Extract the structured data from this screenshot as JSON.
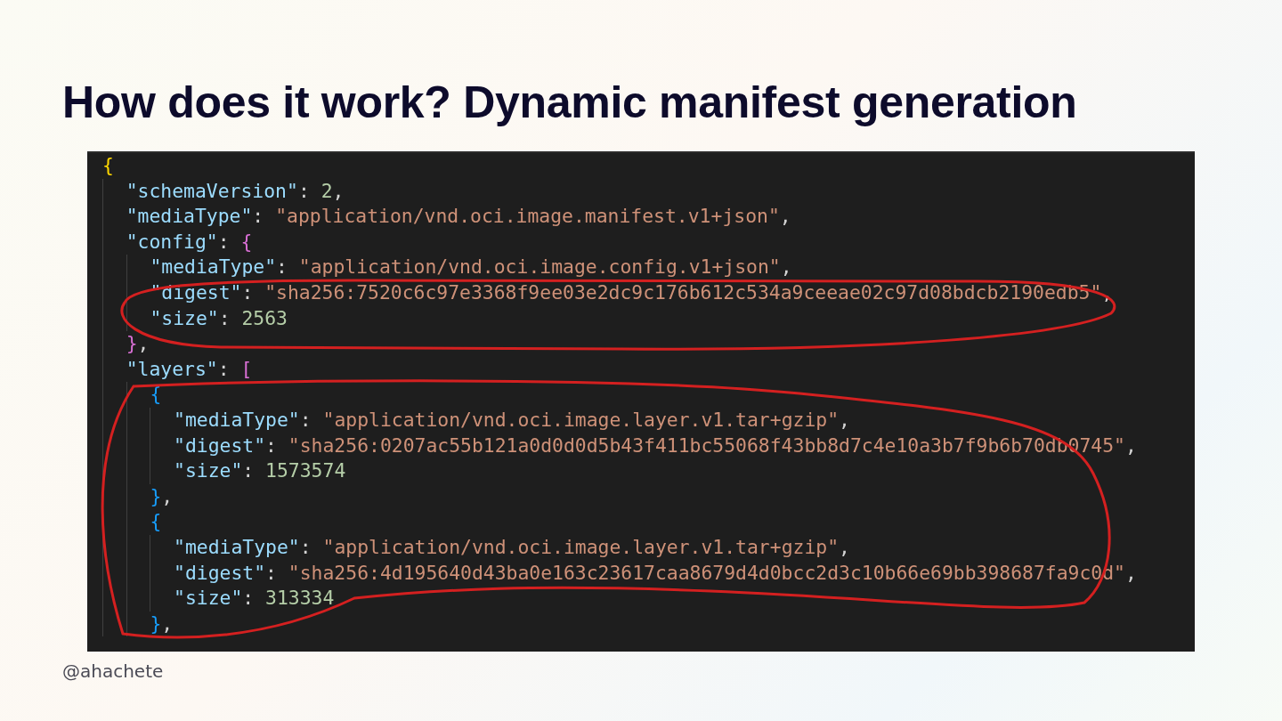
{
  "slide": {
    "title": "How does it work? Dynamic manifest generation",
    "handle": "@ahachete"
  },
  "code": [
    {
      "tokens": [
        {
          "kind": "brace",
          "text": "{",
          "color": "#ffd700"
        }
      ],
      "children": [
        {
          "tokens": [
            {
              "kind": "key",
              "text": "\"schemaVersion\""
            },
            {
              "kind": "punct",
              "text": ": "
            },
            {
              "kind": "num",
              "text": "2"
            },
            {
              "kind": "punct",
              "text": ","
            }
          ]
        },
        {
          "tokens": [
            {
              "kind": "key",
              "text": "\"mediaType\""
            },
            {
              "kind": "punct",
              "text": ": "
            },
            {
              "kind": "str",
              "text": "\"application/vnd.oci.image.manifest.v1+json\""
            },
            {
              "kind": "punct",
              "text": ","
            }
          ]
        },
        {
          "tokens": [
            {
              "kind": "key",
              "text": "\"config\""
            },
            {
              "kind": "punct",
              "text": ": "
            },
            {
              "kind": "brace",
              "text": "{",
              "color": "#da70d6"
            }
          ],
          "children": [
            {
              "tokens": [
                {
                  "kind": "key",
                  "text": "\"mediaType\""
                },
                {
                  "kind": "punct",
                  "text": ": "
                },
                {
                  "kind": "str",
                  "text": "\"application/vnd.oci.image.config.v1+json\""
                },
                {
                  "kind": "punct",
                  "text": ","
                }
              ]
            },
            {
              "tokens": [
                {
                  "kind": "key",
                  "text": "\"digest\""
                },
                {
                  "kind": "punct",
                  "text": ": "
                },
                {
                  "kind": "str",
                  "text": "\"sha256:7520c6c97e3368f9ee03e2dc9c176b612c534a9ceeae02c97d08bdcb2190edb5\""
                },
                {
                  "kind": "punct",
                  "text": ","
                }
              ]
            },
            {
              "tokens": [
                {
                  "kind": "key",
                  "text": "\"size\""
                },
                {
                  "kind": "punct",
                  "text": ": "
                },
                {
                  "kind": "num",
                  "text": "2563"
                }
              ]
            }
          ]
        },
        {
          "tokens": [
            {
              "kind": "brace",
              "text": "}",
              "color": "#da70d6"
            },
            {
              "kind": "punct",
              "text": ","
            }
          ]
        },
        {
          "tokens": [
            {
              "kind": "key",
              "text": "\"layers\""
            },
            {
              "kind": "punct",
              "text": ": "
            },
            {
              "kind": "brace",
              "text": "[",
              "color": "#da70d6"
            }
          ],
          "children": [
            {
              "tokens": [
                {
                  "kind": "brace",
                  "text": "{",
                  "color": "#179fff"
                }
              ],
              "children": [
                {
                  "tokens": [
                    {
                      "kind": "key",
                      "text": "\"mediaType\""
                    },
                    {
                      "kind": "punct",
                      "text": ": "
                    },
                    {
                      "kind": "str",
                      "text": "\"application/vnd.oci.image.layer.v1.tar+gzip\""
                    },
                    {
                      "kind": "punct",
                      "text": ","
                    }
                  ]
                },
                {
                  "tokens": [
                    {
                      "kind": "key",
                      "text": "\"digest\""
                    },
                    {
                      "kind": "punct",
                      "text": ": "
                    },
                    {
                      "kind": "str",
                      "text": "\"sha256:0207ac55b121a0d0d0d5b43f411bc55068f43bb8d7c4e10a3b7f9b6b70db0745\""
                    },
                    {
                      "kind": "punct",
                      "text": ","
                    }
                  ]
                },
                {
                  "tokens": [
                    {
                      "kind": "key",
                      "text": "\"size\""
                    },
                    {
                      "kind": "punct",
                      "text": ": "
                    },
                    {
                      "kind": "num",
                      "text": "1573574"
                    }
                  ]
                }
              ]
            },
            {
              "tokens": [
                {
                  "kind": "brace",
                  "text": "}",
                  "color": "#179fff"
                },
                {
                  "kind": "punct",
                  "text": ","
                }
              ]
            },
            {
              "tokens": [
                {
                  "kind": "brace",
                  "text": "{",
                  "color": "#179fff"
                }
              ],
              "children": [
                {
                  "tokens": [
                    {
                      "kind": "key",
                      "text": "\"mediaType\""
                    },
                    {
                      "kind": "punct",
                      "text": ": "
                    },
                    {
                      "kind": "str",
                      "text": "\"application/vnd.oci.image.layer.v1.tar+gzip\""
                    },
                    {
                      "kind": "punct",
                      "text": ","
                    }
                  ]
                },
                {
                  "tokens": [
                    {
                      "kind": "key",
                      "text": "\"digest\""
                    },
                    {
                      "kind": "punct",
                      "text": ": "
                    },
                    {
                      "kind": "str",
                      "text": "\"sha256:4d195640d43ba0e163c23617caa8679d4d0bcc2d3c10b66e69bb398687fa9c0d\""
                    },
                    {
                      "kind": "punct",
                      "text": ","
                    }
                  ]
                },
                {
                  "tokens": [
                    {
                      "kind": "key",
                      "text": "\"size\""
                    },
                    {
                      "kind": "punct",
                      "text": ": "
                    },
                    {
                      "kind": "num",
                      "text": "313334"
                    }
                  ]
                }
              ]
            },
            {
              "tokens": [
                {
                  "kind": "brace",
                  "text": "}",
                  "color": "#179fff"
                },
                {
                  "kind": "punct",
                  "text": ","
                }
              ]
            }
          ]
        }
      ]
    }
  ]
}
